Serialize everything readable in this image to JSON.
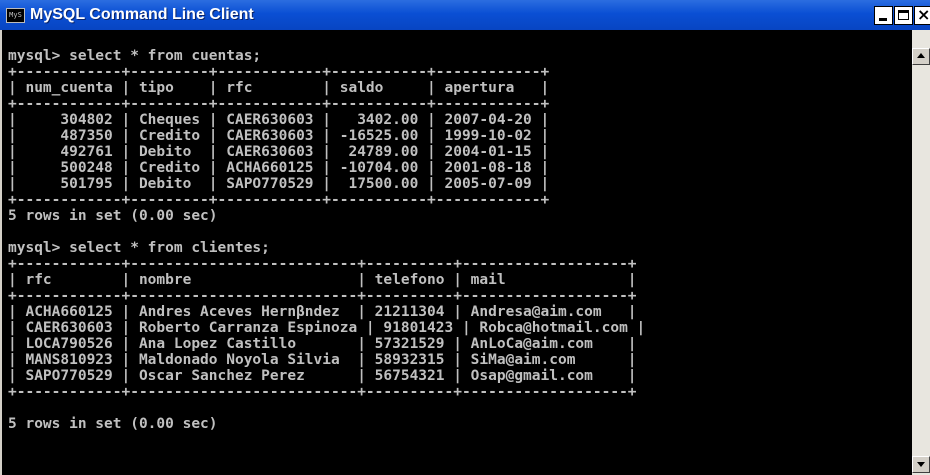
{
  "window": {
    "title": "MySQL Command Line Client",
    "icon_text": "MyS",
    "icon_name": "console-app-icon",
    "title_bar_color": "#0a4fd4",
    "controls": [
      "minimize-icon",
      "maximize-icon",
      "close-icon"
    ]
  },
  "console": {
    "background_color": "#000000",
    "text_color": "#c0c0c0",
    "lines": [
      "",
      "mysql> select * from cuentas;",
      "+------------+---------+------------+-----------+------------+",
      "| num_cuenta | tipo    | rfc        | saldo     | apertura   |",
      "+------------+---------+------------+-----------+------------+",
      "|     304802 | Cheques | CAER630603 |   3402.00 | 2007-04-20 |",
      "|     487350 | Credito | CAER630603 | -16525.00 | 1999-10-02 |",
      "|     492761 | Debito  | CAER630603 |  24789.00 | 2004-01-15 |",
      "|     500248 | Credito | ACHA660125 | -10704.00 | 2001-08-18 |",
      "|     501795 | Debito  | SAPO770529 |  17500.00 | 2005-07-09 |",
      "+------------+---------+------------+-----------+------------+",
      "5 rows in set (0.00 sec)",
      "",
      "mysql> select * from clientes;",
      "+------------+--------------------------+----------+-------------------+",
      "| rfc        | nombre                   | telefono | mail              |",
      "+------------+--------------------------+----------+-------------------+",
      "| ACHA660125 | Andres Aceves Hernβndez  | 21211304 | Andresa@aim.com   |",
      "| CAER630603 | Roberto Carranza Espinoza | 91801423 | Robca@hotmail.com |",
      "| LOCA790526 | Ana Lopez Castillo       | 57321529 | AnLoCa@aim.com    |",
      "| MANS810923 | Maldonado Noyola Silvia  | 58932315 | SiMa@aim.com      |",
      "| SAPO770529 | Oscar Sanchez Perez      | 56754321 | Osap@gmail.com    |",
      "+------------+--------------------------+----------+-------------------+",
      "",
      "5 rows in set (0.00 sec)",
      ""
    ]
  },
  "scrollbar": {
    "up_icon": "scroll-up-arrow-icon",
    "down_icon": "scroll-down-arrow-icon"
  }
}
